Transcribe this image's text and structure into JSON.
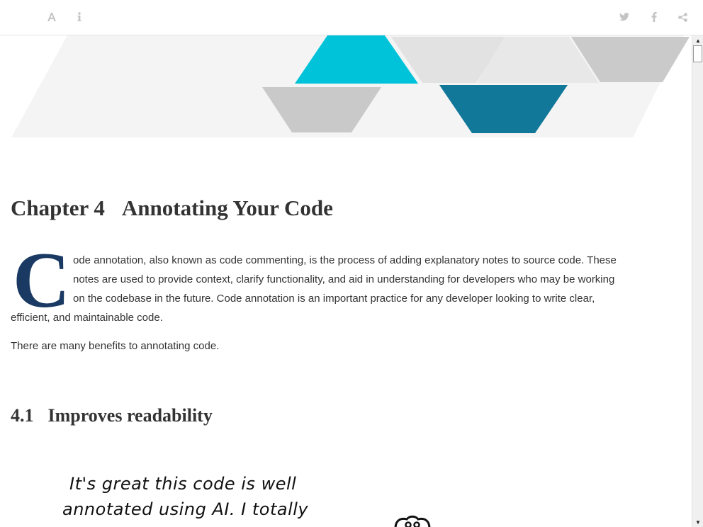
{
  "toolbar": {
    "left_icons": [
      "font-settings-icon",
      "info-icon"
    ],
    "right_icons": [
      "twitter-icon",
      "facebook-icon",
      "share-icon"
    ]
  },
  "banner": {
    "colors": {
      "background": "#f4f4f4",
      "cyan": "#00c3d9",
      "teal": "#11789a",
      "grey": "#c9c9c9",
      "light_grey": "#e4e4e4"
    }
  },
  "chapter": {
    "number": "Chapter 4",
    "title": "Annotating Your Code"
  },
  "intro": {
    "dropcap": "C",
    "line1": "ode annotation, also known as code commenting, is the process of adding explanatory notes to source code. These",
    "line2": "notes are used to provide context, clarify functionality, and aid in understanding for developers who may be working",
    "line3": "on the codebase in the future. Code annotation is an important practice for any developer looking to write clear,",
    "line4": "efficient, and maintainable code."
  },
  "paragraph2": "There are many benefits to annotating code.",
  "section": {
    "number": "4.1",
    "title": "Improves readability"
  },
  "comic": {
    "line1": "It's great this code is well",
    "line2": "annotated using AI. I totally"
  },
  "accent_color": "#1b3a63"
}
